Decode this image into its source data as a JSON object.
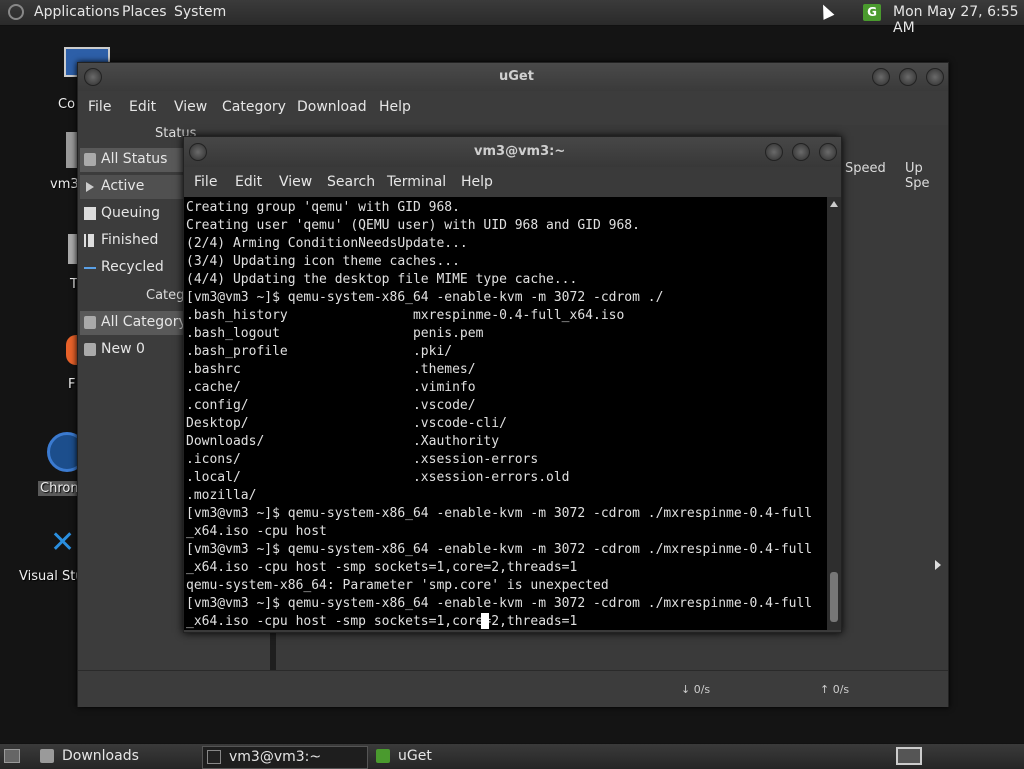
{
  "top_panel": {
    "menus": [
      "Applications",
      "Places",
      "System"
    ],
    "clock": "Mon May 27,  6:55 AM",
    "tray_icon": "uget-tray-icon",
    "tray_label": "G"
  },
  "desktop": {
    "icons": [
      {
        "label": "Co",
        "icon": "computer-icon"
      },
      {
        "label": "vm3",
        "icon": "home-folder-icon"
      },
      {
        "label": "T",
        "icon": "trash-icon"
      },
      {
        "label": "F",
        "icon": "firefox-icon"
      },
      {
        "label": "Chrom",
        "icon": "chromium-icon"
      },
      {
        "label": "Visual Stu",
        "icon": "vscode-icon"
      }
    ]
  },
  "uget": {
    "title": "uGet",
    "menu": [
      "File",
      "Edit",
      "View",
      "Category",
      "Download",
      "Help"
    ],
    "status_header": "Status",
    "status_items": [
      "All Status",
      "Active",
      "Queuing",
      "Finished",
      "Recycled"
    ],
    "category_header": "Categ",
    "category_items": [
      "All Category",
      "New 0"
    ],
    "columns": [
      "Speed",
      "Up Spe"
    ],
    "down_speed": "↓  0/s",
    "up_speed": "↑  0/s"
  },
  "terminal": {
    "title": "vm3@vm3:~",
    "menu": [
      "File",
      "Edit",
      "View",
      "Search",
      "Terminal",
      "Help"
    ],
    "lines": [
      "Creating group 'qemu' with GID 968.",
      "Creating user 'qemu' (QEMU user) with UID 968 and GID 968.",
      "(2/4) Arming ConditionNeedsUpdate...",
      "(3/4) Updating icon theme caches...",
      "(4/4) Updating the desktop file MIME type cache...",
      "[vm3@vm3 ~]$ qemu-system-x86_64 -enable-kvm -m 3072 -cdrom ./",
      ".bash_history                mxrespinme-0.4-full_x64.iso",
      ".bash_logout                 penis.pem",
      ".bash_profile                .pki/",
      ".bashrc                      .themes/",
      ".cache/                      .viminfo",
      ".config/                     .vscode/",
      "Desktop/                     .vscode-cli/",
      "Downloads/                   .Xauthority",
      ".icons/                      .xsession-errors",
      ".local/                      .xsession-errors.old",
      ".mozilla/",
      "[vm3@vm3 ~]$ qemu-system-x86_64 -enable-kvm -m 3072 -cdrom ./mxrespinme-0.4-full",
      "_x64.iso -cpu host",
      "[vm3@vm3 ~]$ qemu-system-x86_64 -enable-kvm -m 3072 -cdrom ./mxrespinme-0.4-full",
      "_x64.iso -cpu host -smp sockets=1,core=2,threads=1",
      "qemu-system-x86_64: Parameter 'smp.core' is unexpected",
      "[vm3@vm3 ~]$ qemu-system-x86_64 -enable-kvm -m 3072 -cdrom ./mxrespinme-0.4-full",
      "_x64.iso -cpu host -smp sockets=1,core=2,threads=1"
    ]
  },
  "taskbar": {
    "tasks": [
      {
        "label": "Downloads",
        "icon": "folder-icon"
      },
      {
        "label": "vm3@vm3:~",
        "icon": "terminal-icon"
      },
      {
        "label": "uGet",
        "icon": "uget-icon"
      }
    ]
  },
  "colors": {
    "uget_green": "#4a9a2e",
    "terminal_bg": "#000000",
    "panel_bg": "#2f2f2f"
  }
}
